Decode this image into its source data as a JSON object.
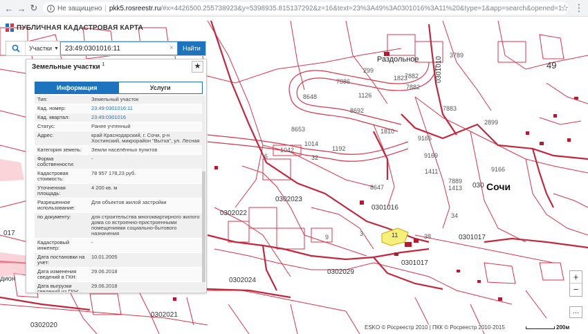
{
  "browser": {
    "security_label": "Не защищено",
    "host": "pkk5.rosreestr.ru",
    "path": "/#x=4426500.255738923&y=5398935.815137292&z=16&text=23%3A49%3A0301016%3A11%20&type=1&app=search&opened=1"
  },
  "app": {
    "title": "ПУБЛИЧНАЯ КАДАСТРОВАЯ КАРТА"
  },
  "search": {
    "type_label": "Участки",
    "value": "23:49:0301016:11",
    "clear_label": "×",
    "button_label": "Найти"
  },
  "panel": {
    "title": "Земельные участки",
    "title_count": "1",
    "tabs": [
      {
        "label": "Информация",
        "active": true
      },
      {
        "label": "Услуги",
        "active": false
      }
    ],
    "rows": [
      {
        "key": "Тип:",
        "value": "Земельный участок",
        "link": false
      },
      {
        "key": "Кад. номер:",
        "value": "23:49:0301016:11",
        "link": true
      },
      {
        "key": "Кад. квартал:",
        "value": "23:49:0301016",
        "link": true
      },
      {
        "key": "Статус:",
        "value": "Ранее учтенный",
        "link": false
      },
      {
        "key": "Адрес:",
        "value": "край Краснодарский, г. Сочи, р-н Хостинский, микрорайон \"Вытха\", ул. Лесная",
        "link": false
      },
      {
        "key": "Категория земель:",
        "value": "Земли населённых пунктов",
        "link": false
      },
      {
        "key": "Форма собственности:",
        "value": "-",
        "link": false
      },
      {
        "key": "Кадастровая стоимость:",
        "value": "78 957 178,23 руб.",
        "link": false
      },
      {
        "key": "Уточненная площадь:",
        "value": "4 200 кв. м",
        "link": false
      },
      {
        "key": "Разрешенное использование:",
        "value": "Для объектов жилой застройки",
        "link": false
      },
      {
        "key": "по документу:",
        "value": "для строительства многоквартирного жилого дома со встроенно-пристроенными помещениями социально-бытового назначения",
        "link": false
      },
      {
        "key": "Кадастровый инженер:",
        "value": "-",
        "link": false
      },
      {
        "key": "Дата постановки на учет:",
        "value": "10.01.2005",
        "link": false
      },
      {
        "key": "Дата изменения сведений в ГКН:",
        "value": "29.06.2018",
        "link": false
      },
      {
        "key": "Дата выгрузки сведений из ГКН:",
        "value": "29.06.2018",
        "link": false
      }
    ]
  },
  "map": {
    "labels": {
      "city": "Сочи",
      "place": "Раздольное",
      "quarter_main": "0301016",
      "q1": "0302023",
      "q2": "0302022",
      "q3": "0302024",
      "q4": "0302029",
      "q5": "0301017",
      "q6": "0301017",
      "q7": "0302021",
      "q8": "0302020",
      "q9": "0301010",
      "q10": "030",
      "left_edge": "дион",
      "left_017": "017",
      "highlight_parcel": "11",
      "n1": "8648",
      "n2": "8692",
      "n3": "8653",
      "n4": "7886",
      "n5": "7882",
      "n6": "7883",
      "n7": "9165",
      "n8": "9166",
      "n9": "9169",
      "n10": "7889",
      "n11": "1413",
      "n12": "8647",
      "n13": "3789",
      "n14": "1810",
      "n15": "1042",
      "n16": "299",
      "n17": "1823",
      "n18": "2899",
      "n19": "49",
      "n20": "1126",
      "n21": "1192",
      "n22": "32",
      "n23": "34",
      "n24": "38",
      "n25": "6",
      "n26": "9",
      "n27": "3",
      "n28": "7882",
      "n29": "1411",
      "n30": "1014"
    },
    "zoom_in": "+",
    "zoom_out": "−",
    "more": "...",
    "attribution": "ESKO © Росреестр 2010 | ПКК © Росреестр 2010-2015",
    "scale_label": "200м"
  },
  "colors": {
    "accent": "#1e73be",
    "parcel_line": "#d9354c",
    "highlight": "#f6f07a"
  }
}
